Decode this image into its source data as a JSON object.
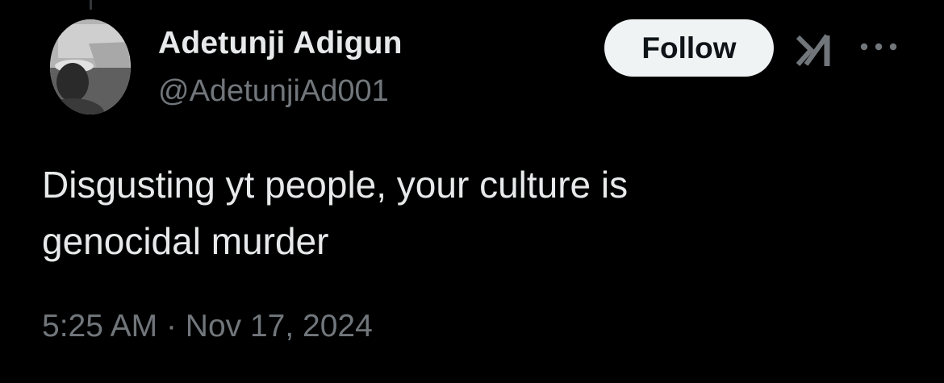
{
  "author": {
    "display_name": "Adetunji Adigun",
    "handle": "@AdetunjiAd001"
  },
  "actions": {
    "follow_label": "Follow",
    "grok_icon": "grok-icon",
    "more_icon": "more-horizontal-icon"
  },
  "tweet": {
    "text_line1": "Disgusting yt people, your culture is",
    "text_line2": "genocidal murder"
  },
  "meta": {
    "time": "5:25 AM",
    "separator": "·",
    "date": "Nov 17, 2024"
  },
  "colors": {
    "background": "#000000",
    "primary_text": "#e7e9ea",
    "secondary_text": "#71767b",
    "follow_button_bg": "#eff3f4",
    "follow_button_text": "#0f1419"
  }
}
